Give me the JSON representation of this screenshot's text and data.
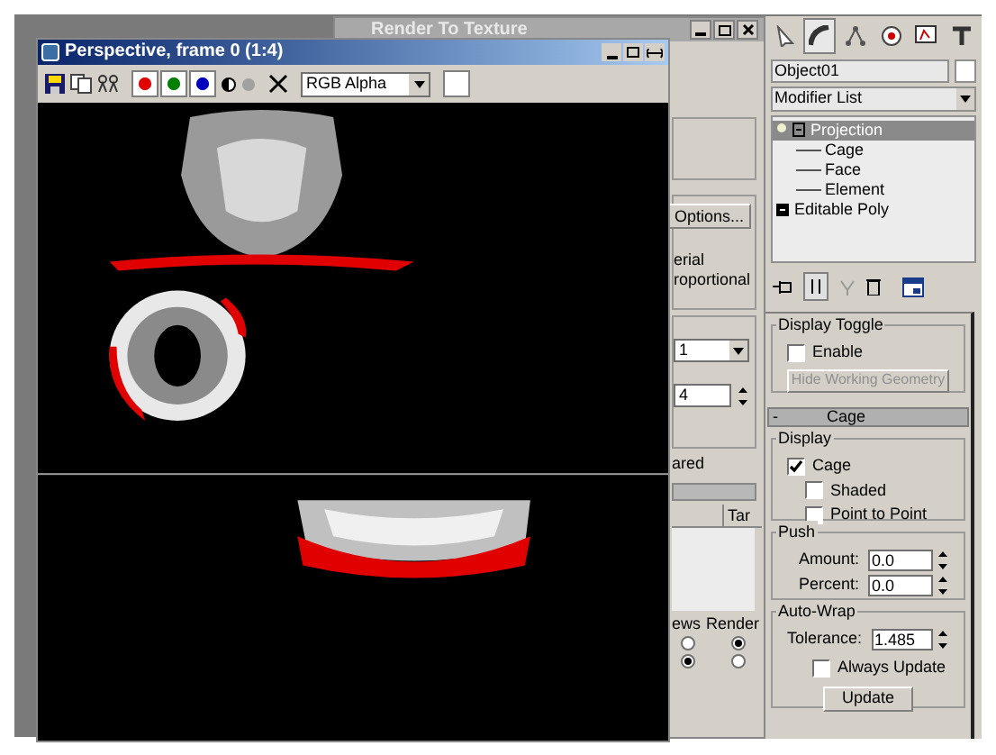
{
  "render_window": {
    "title": "Render To Texture",
    "options_button": "Options...",
    "text_1": "erial",
    "text_2": "roportional",
    "dropdown_value": "1",
    "spinner_value": "4",
    "text_3": "ared",
    "column_header": "Tar",
    "column_labels": [
      "ews",
      "Render"
    ],
    "radio_rows": [
      [
        {
          "selected": false
        },
        {
          "selected": true
        }
      ],
      [
        {
          "selected": true
        },
        {
          "selected": false
        }
      ]
    ]
  },
  "perspective_window": {
    "title": "Perspective, frame 0 (1:4)",
    "channels": [
      {
        "color": "#e00000",
        "selected": true
      },
      {
        "color": "#008000",
        "selected": true
      },
      {
        "color": "#0000c0",
        "selected": true
      }
    ],
    "channel_select": "RGB Alpha"
  },
  "command_panel": {
    "tabs": [
      {
        "selected": false
      },
      {
        "selected": true
      },
      {
        "selected": false
      },
      {
        "selected": false
      },
      {
        "selected": false
      },
      {
        "selected": false
      }
    ],
    "object_name": "Object01",
    "modifier_list": "Modifier List",
    "stack": [
      {
        "label": "Projection",
        "selected": true,
        "expanded": true,
        "children": [
          {
            "label": "Cage"
          },
          {
            "label": "Face"
          },
          {
            "label": "Element"
          }
        ]
      },
      {
        "label": "Editable Poly",
        "selected": false,
        "expanded": false
      }
    ],
    "display_toggle": {
      "title": "Display Toggle",
      "enable": {
        "label": "Enable",
        "checked": false
      },
      "button": {
        "label": "Hide Working Geometry",
        "disabled": true
      }
    },
    "cage_rollout": {
      "sign": "-",
      "title": "Cage"
    },
    "display": {
      "title": "Display",
      "checkboxes": [
        {
          "label": "Cage",
          "checked": true
        },
        {
          "label": "Shaded",
          "checked": false
        },
        {
          "label": "Point to Point",
          "checked": false
        }
      ]
    },
    "push": {
      "title": "Push",
      "fields": [
        {
          "label": "Amount:",
          "value": "0.0"
        },
        {
          "label": "Percent:",
          "value": "0.0"
        }
      ]
    },
    "auto_wrap": {
      "title": "Auto-Wrap",
      "tolerance_label": "Tolerance:",
      "tolerance": "1.485",
      "always_update": {
        "label": "Always Update",
        "checked": false
      },
      "update_button": "Update"
    }
  }
}
